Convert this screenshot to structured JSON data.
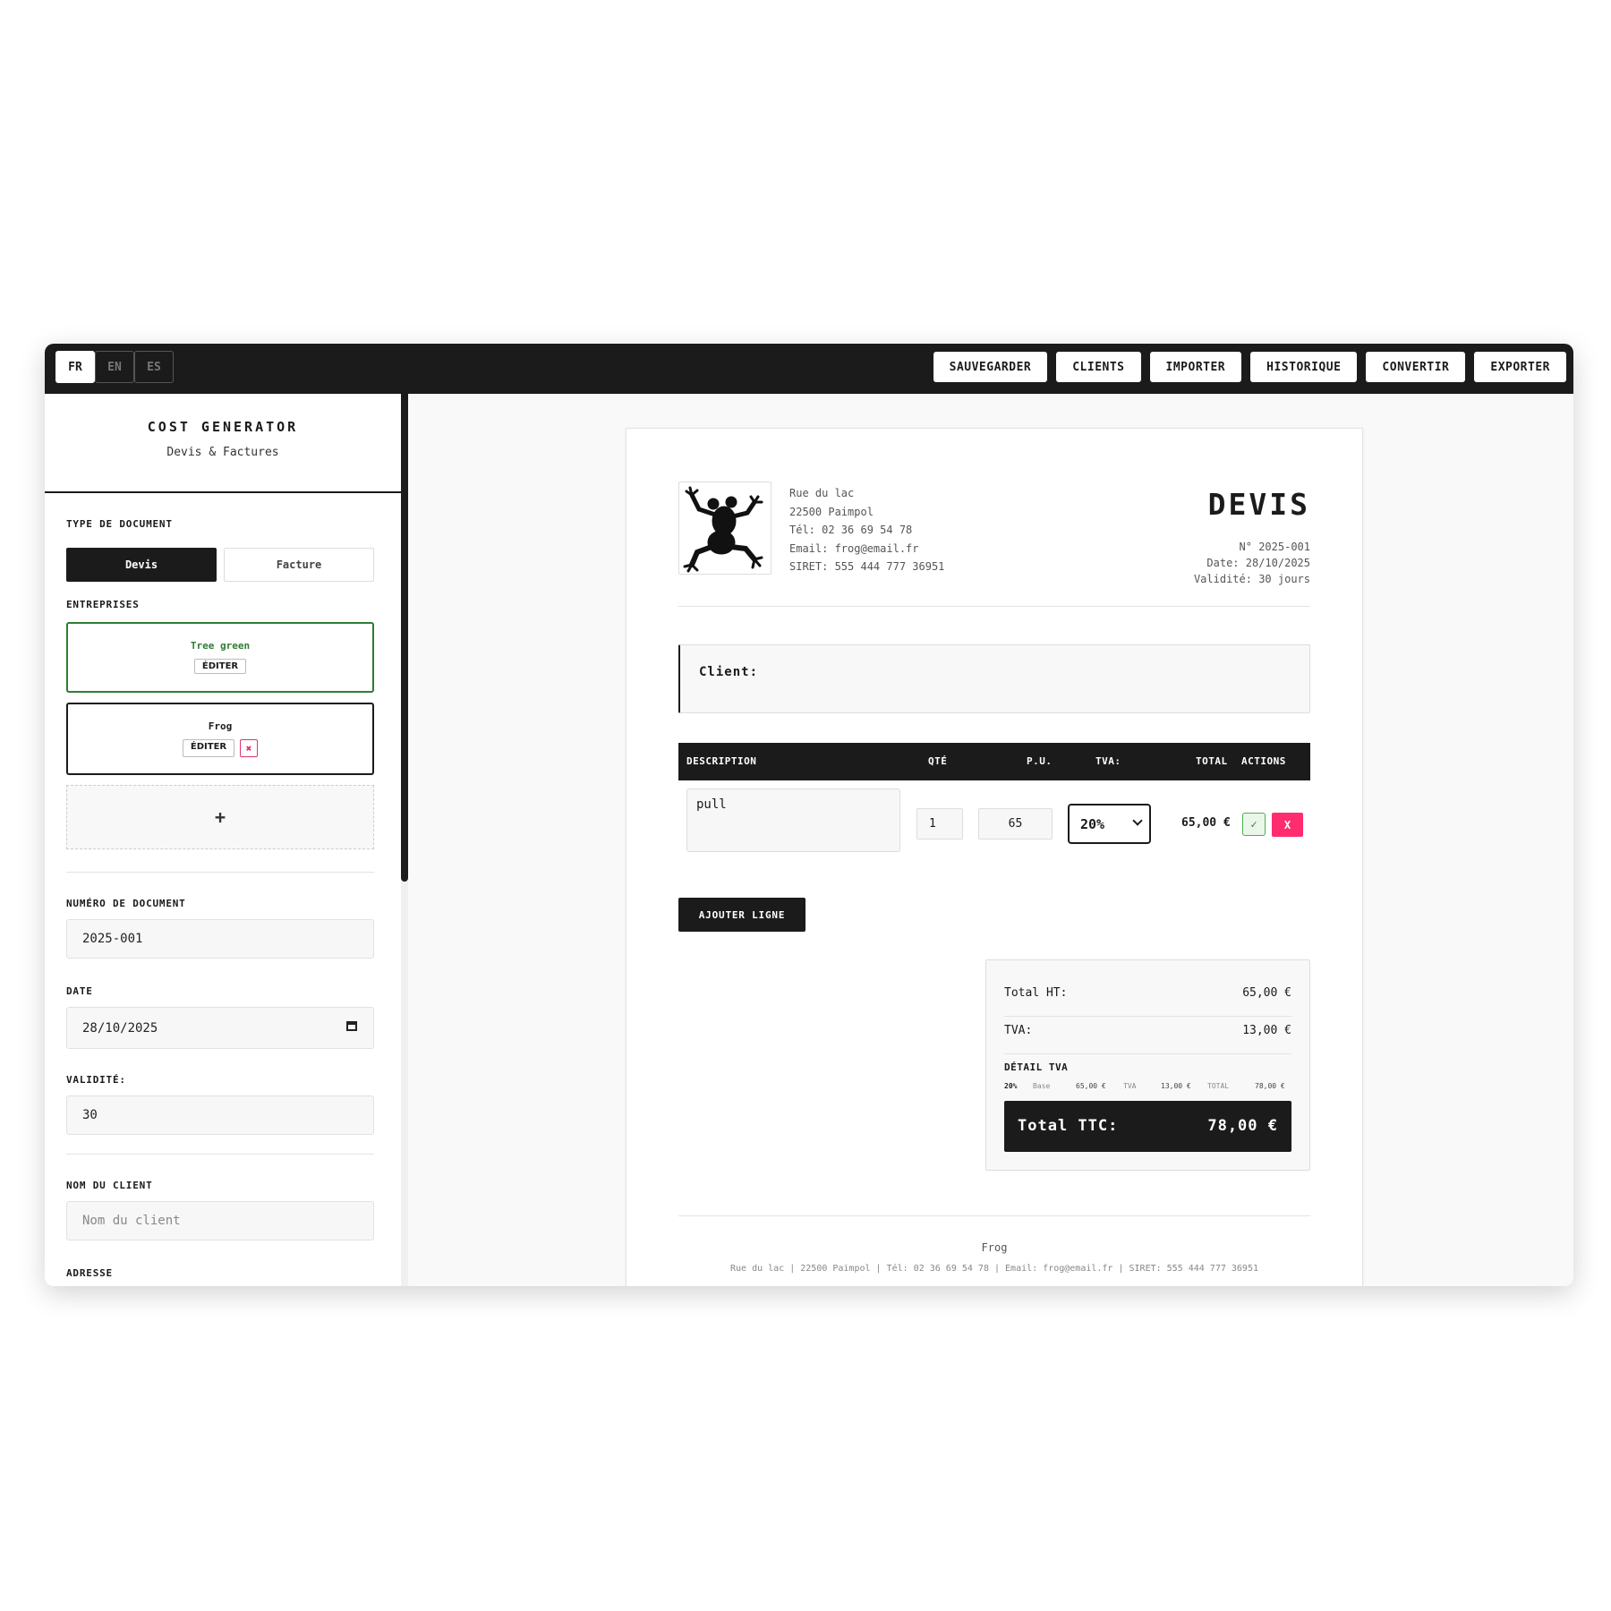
{
  "languages": [
    {
      "label": "FR",
      "active": true
    },
    {
      "label": "EN",
      "active": false
    },
    {
      "label": "ES",
      "active": false
    }
  ],
  "toolbar": {
    "save": "SAUVEGARDER",
    "clients": "CLIENTS",
    "import": "IMPORTER",
    "history": "HISTORIQUE",
    "convert": "CONVERTIR",
    "export": "EXPORTER"
  },
  "sidebar": {
    "app_title": "COST GENERATOR",
    "app_subtitle": "Devis & Factures",
    "doc_type_label": "TYPE DE DOCUMENT",
    "doc_type_options": [
      "Devis",
      "Facture"
    ],
    "doc_type_selected": "Devis",
    "companies_label": "ENTREPRISES",
    "companies": [
      {
        "name": "Tree green",
        "edit_label": "ÉDITER",
        "selected": true
      },
      {
        "name": "Frog",
        "edit_label": "ÉDITER",
        "delete_label": "✖",
        "selected": false
      }
    ],
    "add_company_label": "+",
    "doc_number_label": "NUMÉRO DE DOCUMENT",
    "doc_number_value": "2025-001",
    "date_label": "DATE",
    "date_value": "28/10/2025",
    "validity_label": "VALIDITÉ:",
    "validity_value": "30",
    "client_name_label": "NOM DU CLIENT",
    "client_name_placeholder": "Nom du client",
    "address_label": "ADRESSE"
  },
  "preview": {
    "logo_icon": "frog-logo",
    "company_lines": [
      "Rue du lac",
      "22500 Paimpol",
      "Tél: 02 36 69 54 78",
      "Email: frog@email.fr",
      "SIRET: 555 444 777 36951"
    ],
    "doc_title": "DEVIS",
    "doc_number": "N° 2025-001",
    "doc_date": "Date: 28/10/2025",
    "doc_validity": "Validité: 30 jours",
    "client_label": "Client:",
    "table_headers": {
      "description": "DESCRIPTION",
      "qty": "QTÉ",
      "unit_price": "P.U.",
      "vat": "TVA:",
      "total": "TOTAL",
      "actions": "ACTIONS"
    },
    "lines": [
      {
        "description": "pull",
        "qty": "1",
        "unit_price": "65",
        "vat": "20%",
        "total": "65,00 €",
        "ok_label": "✓",
        "delete_label": "X"
      }
    ],
    "add_line_label": "AJOUTER LIGNE",
    "totals": {
      "ht_label": "Total HT:",
      "ht_value": "65,00 €",
      "tva_label": "TVA:",
      "tva_value": "13,00 €",
      "vat_detail_title": "DÉTAIL TVA",
      "vat_detail": {
        "rate": "20%",
        "base_label": "Base",
        "base_value": "65,00 €",
        "tva_label": "TVA",
        "tva_value": "13,00 €",
        "total_label": "TOTAL",
        "total_value": "78,00 €"
      },
      "ttc_label": "Total TTC:",
      "ttc_value": "78,00 €"
    },
    "footer_name": "Frog",
    "footer_line": "Rue du lac | 22500 Paimpol | Tél: 02 36 69 54 78 | Email: frog@email.fr | SIRET: 555 444 777 36951"
  },
  "colors": {
    "dark": "#1b1b1b",
    "selected_company": "#2e7d32",
    "delete_accent": "#ff2d6f",
    "ok_accent": "#4caf50"
  }
}
